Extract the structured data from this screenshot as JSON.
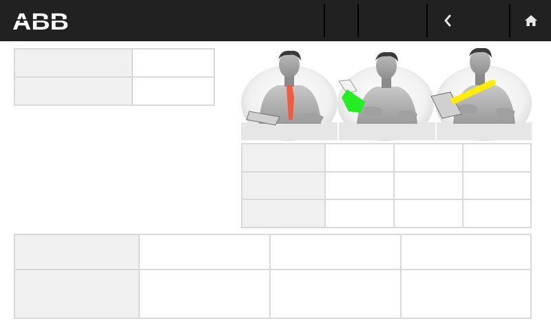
{
  "brand": {
    "logo_text": "ABB"
  },
  "topbar": {
    "background": "#212121",
    "buttons": [
      {
        "name": "slot-1",
        "label": ""
      },
      {
        "name": "slot-2",
        "label": ""
      },
      {
        "name": "back",
        "icon": "chevron-left-icon"
      },
      {
        "name": "home",
        "icon": "home-icon"
      }
    ]
  },
  "colors": {
    "header_cell": "#f0f0f0",
    "grid_line": "#d9d9d9",
    "tie_red": "#f05a40",
    "tablet_green": "#22ee22",
    "pen_yellow": "#ffee00"
  },
  "illustration": {
    "figures": [
      {
        "name": "red-tie-figure",
        "highlight": "red tie"
      },
      {
        "name": "green-tablet-figure",
        "highlight": "green tablet"
      },
      {
        "name": "yellow-pen-figure",
        "highlight": "yellow pen"
      }
    ]
  },
  "table_top_left": {
    "rows": [
      [
        "",
        ""
      ],
      [
        "",
        ""
      ]
    ]
  },
  "table_right": {
    "rows": [
      [
        "",
        "",
        "",
        ""
      ],
      [
        "",
        "",
        "",
        ""
      ],
      [
        "",
        "",
        "",
        ""
      ]
    ]
  },
  "table_bottom": {
    "rows": [
      [
        "",
        "",
        "",
        ""
      ],
      [
        "",
        "",
        "",
        ""
      ]
    ]
  }
}
